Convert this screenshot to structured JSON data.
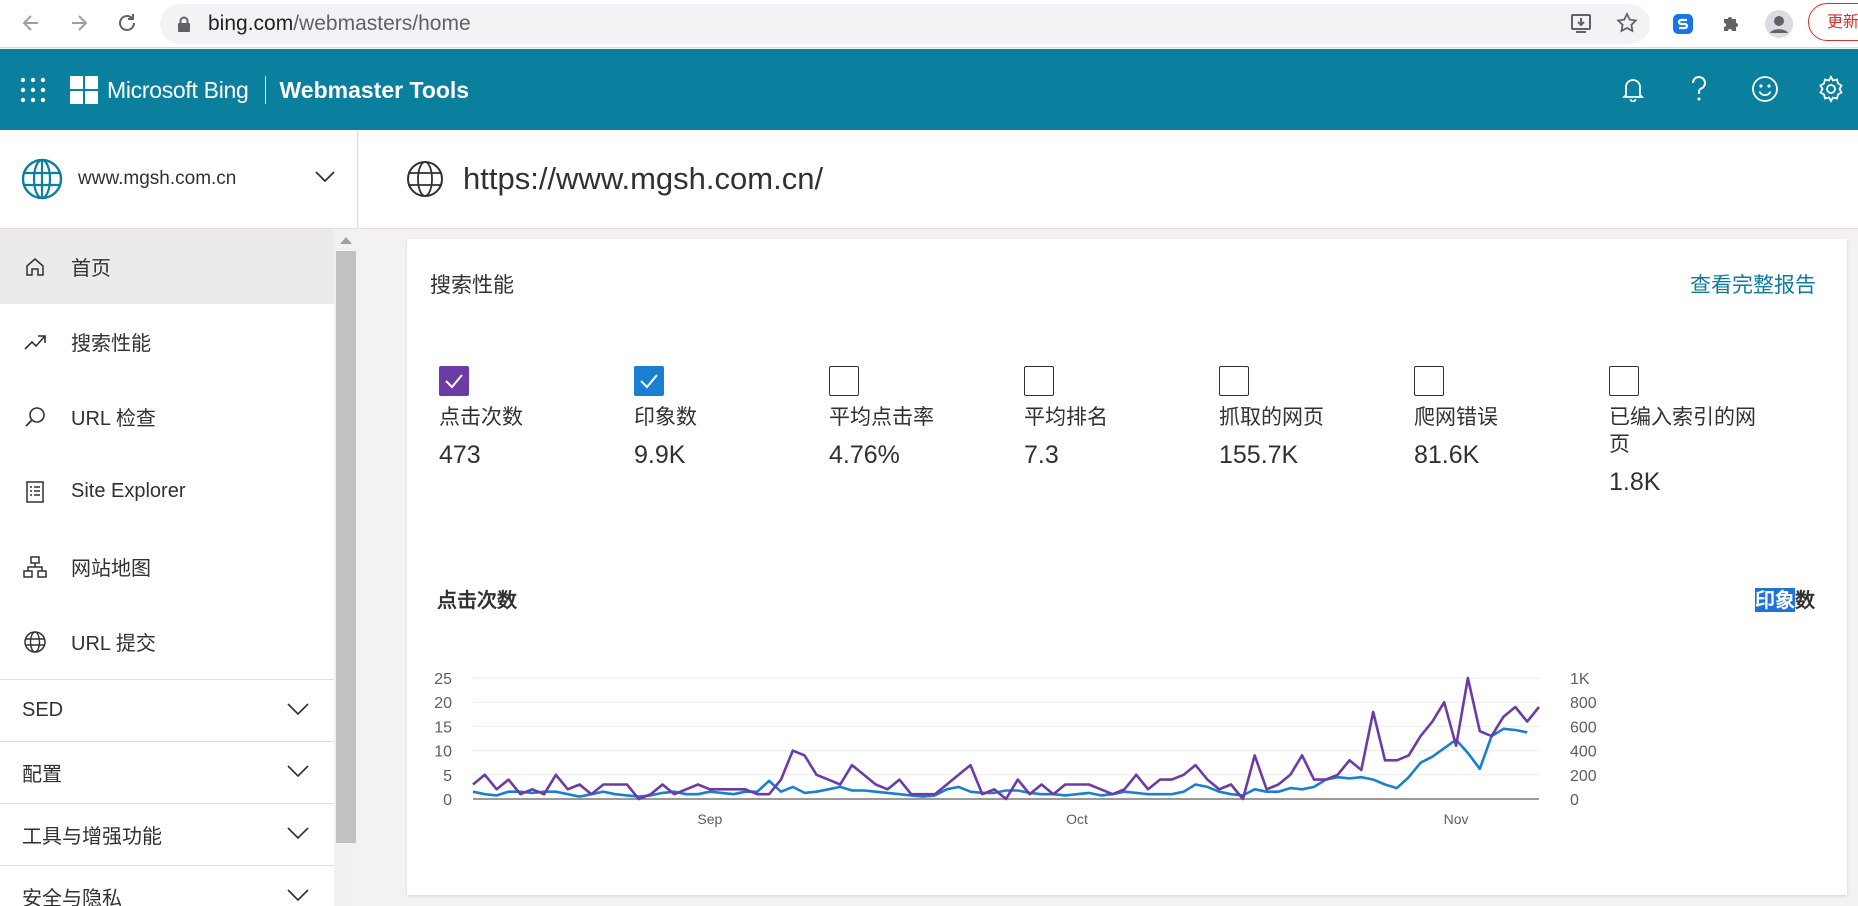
{
  "browser": {
    "url_domain": "bing.com",
    "url_path": "/webmasters/home",
    "update_label": "更新"
  },
  "header": {
    "brand": "Microsoft Bing",
    "product": "Webmaster Tools"
  },
  "sidebar": {
    "site": "www.mgsh.com.cn",
    "items": [
      {
        "label": "首页",
        "icon": "home-icon"
      },
      {
        "label": "搜索性能",
        "icon": "trending-icon"
      },
      {
        "label": "URL 检查",
        "icon": "search-icon"
      },
      {
        "label": "Site Explorer",
        "icon": "document-icon"
      },
      {
        "label": "网站地图",
        "icon": "sitemap-icon"
      },
      {
        "label": "URL 提交",
        "icon": "globe-icon"
      }
    ],
    "groups": [
      {
        "label": "SED"
      },
      {
        "label": "配置"
      },
      {
        "label": "工具与增强功能"
      },
      {
        "label": "安全与隐私"
      }
    ]
  },
  "main": {
    "site_url": "https://www.mgsh.com.cn/",
    "card_title": "搜索性能",
    "card_link": "查看完整报告",
    "metrics": [
      {
        "label": "点击次数",
        "value": "473",
        "checked": true,
        "color": "#6d3ba6"
      },
      {
        "label": "印象数",
        "value": "9.9K",
        "checked": true,
        "color": "#1a7fd0"
      },
      {
        "label": "平均点击率",
        "value": "4.76%",
        "checked": false
      },
      {
        "label": "平均排名",
        "value": "7.3",
        "checked": false
      },
      {
        "label": "抓取的网页",
        "value": "155.7K",
        "checked": false
      },
      {
        "label": "爬网错误",
        "value": "81.6K",
        "checked": false
      },
      {
        "label": "已编入索引的网页",
        "value": "1.8K",
        "checked": false
      }
    ],
    "chart_left_title": "点击次数",
    "chart_right_title_hl": "印象",
    "chart_right_title_rest": "数"
  },
  "chart_data": {
    "type": "line",
    "left_axis": {
      "ticks": [
        "25",
        "20",
        "15",
        "10",
        "5",
        "0"
      ],
      "ylim": [
        0,
        25
      ]
    },
    "right_axis": {
      "ticks": [
        "1K",
        "800",
        "600",
        "400",
        "200",
        "0"
      ],
      "ylim": [
        0,
        1000
      ]
    },
    "x_ticks": [
      {
        "label": "Sep",
        "index": 20
      },
      {
        "label": "Oct",
        "index": 51
      },
      {
        "label": "Nov",
        "index": 83
      }
    ],
    "series": [
      {
        "name": "点击次数",
        "axis": "left",
        "color": "#6d3ba6",
        "values": [
          3,
          5,
          2,
          4,
          1,
          2,
          1,
          5,
          2,
          3,
          1,
          3,
          3,
          3,
          0,
          1,
          3,
          1,
          2,
          3,
          2,
          2,
          2,
          2,
          1,
          1,
          4,
          10,
          9,
          5,
          4,
          3,
          7,
          5,
          3,
          2,
          4,
          1,
          1,
          1,
          3,
          5,
          7,
          1,
          2,
          0,
          4,
          1,
          3,
          1,
          3,
          3,
          3,
          2,
          1,
          2,
          5,
          2,
          4,
          4,
          5,
          7,
          4,
          2,
          3,
          0,
          9,
          2,
          3,
          5,
          9,
          4,
          4,
          5,
          8,
          6,
          18,
          8,
          8,
          9,
          13,
          16,
          20,
          11,
          25,
          14,
          13,
          17,
          19,
          16,
          19
        ]
      },
      {
        "name": "印象数",
        "axis": "right",
        "color": "#1a7fd0",
        "values": [
          60,
          40,
          30,
          60,
          60,
          50,
          60,
          60,
          40,
          20,
          40,
          60,
          40,
          30,
          20,
          30,
          50,
          60,
          40,
          40,
          60,
          50,
          40,
          60,
          60,
          150,
          60,
          100,
          50,
          60,
          80,
          100,
          70,
          70,
          60,
          50,
          40,
          30,
          20,
          30,
          80,
          100,
          60,
          50,
          50,
          70,
          70,
          50,
          40,
          40,
          30,
          40,
          50,
          30,
          40,
          60,
          50,
          40,
          40,
          40,
          60,
          120,
          100,
          60,
          40,
          30,
          80,
          60,
          60,
          90,
          80,
          100,
          160,
          180,
          170,
          180,
          160,
          120,
          90,
          180,
          300,
          350,
          420,
          490,
          380,
          250,
          520,
          580,
          570,
          550
        ]
      }
    ]
  }
}
